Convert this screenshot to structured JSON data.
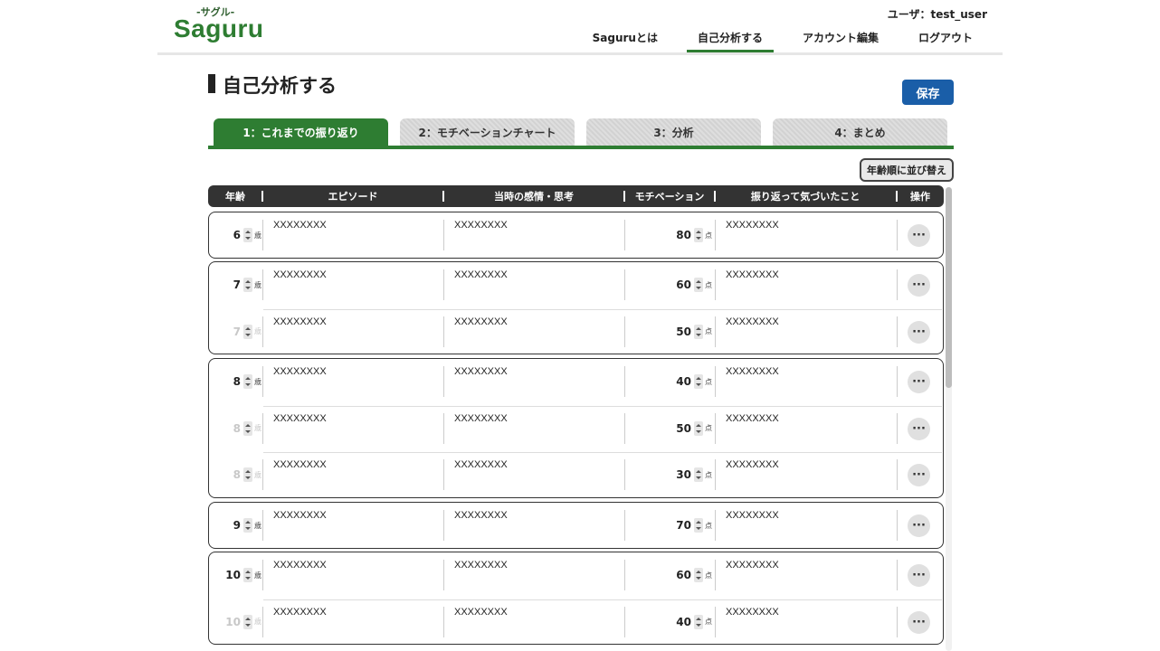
{
  "header": {
    "logo_sub": "-サグル-",
    "logo": "Saguru",
    "user": "ユーザ：test_user",
    "nav": [
      "Saguruとは",
      "自己分析する",
      "アカウント編集",
      "ログアウト"
    ],
    "nav_active": "自己分析する"
  },
  "page": {
    "title": "自己分析する",
    "save_label": "保存"
  },
  "tabs": [
    {
      "label": "1：これまでの振り返り",
      "active": true
    },
    {
      "label": "2：モチベーションチャート",
      "active": false
    },
    {
      "label": "3：分析",
      "active": false
    },
    {
      "label": "4：まとめ",
      "active": false
    }
  ],
  "sort_label": "年齢順に並び替え",
  "table": {
    "headers": [
      "年齢",
      "エピソード",
      "当時の感情・思考",
      "モチベーション",
      "振り返って気づいたこと",
      "操作"
    ],
    "age_unit": "歳",
    "score_unit": "点",
    "op_label": "···",
    "groups": [
      {
        "rows": [
          {
            "age": "6",
            "episode": "XXXXXXXX",
            "feeling": "XXXXXXXX",
            "motivation": "80",
            "notice": "XXXXXXXX"
          }
        ]
      },
      {
        "rows": [
          {
            "age": "7",
            "episode": "XXXXXXXX",
            "feeling": "XXXXXXXX",
            "motivation": "60",
            "notice": "XXXXXXXX"
          },
          {
            "age": "7",
            "episode": "XXXXXXXX",
            "feeling": "XXXXXXXX",
            "motivation": "50",
            "notice": "XXXXXXXX"
          }
        ]
      },
      {
        "rows": [
          {
            "age": "8",
            "episode": "XXXXXXXX",
            "feeling": "XXXXXXXX",
            "motivation": "40",
            "notice": "XXXXXXXX"
          },
          {
            "age": "8",
            "episode": "XXXXXXXX",
            "feeling": "XXXXXXXX",
            "motivation": "50",
            "notice": "XXXXXXXX"
          },
          {
            "age": "8",
            "episode": "XXXXXXXX",
            "feeling": "XXXXXXXX",
            "motivation": "30",
            "notice": "XXXXXXXX"
          }
        ]
      },
      {
        "rows": [
          {
            "age": "9",
            "episode": "XXXXXXXX",
            "feeling": "XXXXXXXX",
            "motivation": "70",
            "notice": "XXXXXXXX"
          }
        ]
      },
      {
        "rows": [
          {
            "age": "10",
            "episode": "XXXXXXXX",
            "feeling": "XXXXXXXX",
            "motivation": "60",
            "notice": "XXXXXXXX"
          },
          {
            "age": "10",
            "episode": "XXXXXXXX",
            "feeling": "XXXXXXXX",
            "motivation": "40",
            "notice": "XXXXXXXX"
          }
        ]
      }
    ]
  },
  "colors": {
    "accent_green": "#2e7d32",
    "save_blue": "#1a5ea8",
    "header_dark": "#333333"
  }
}
